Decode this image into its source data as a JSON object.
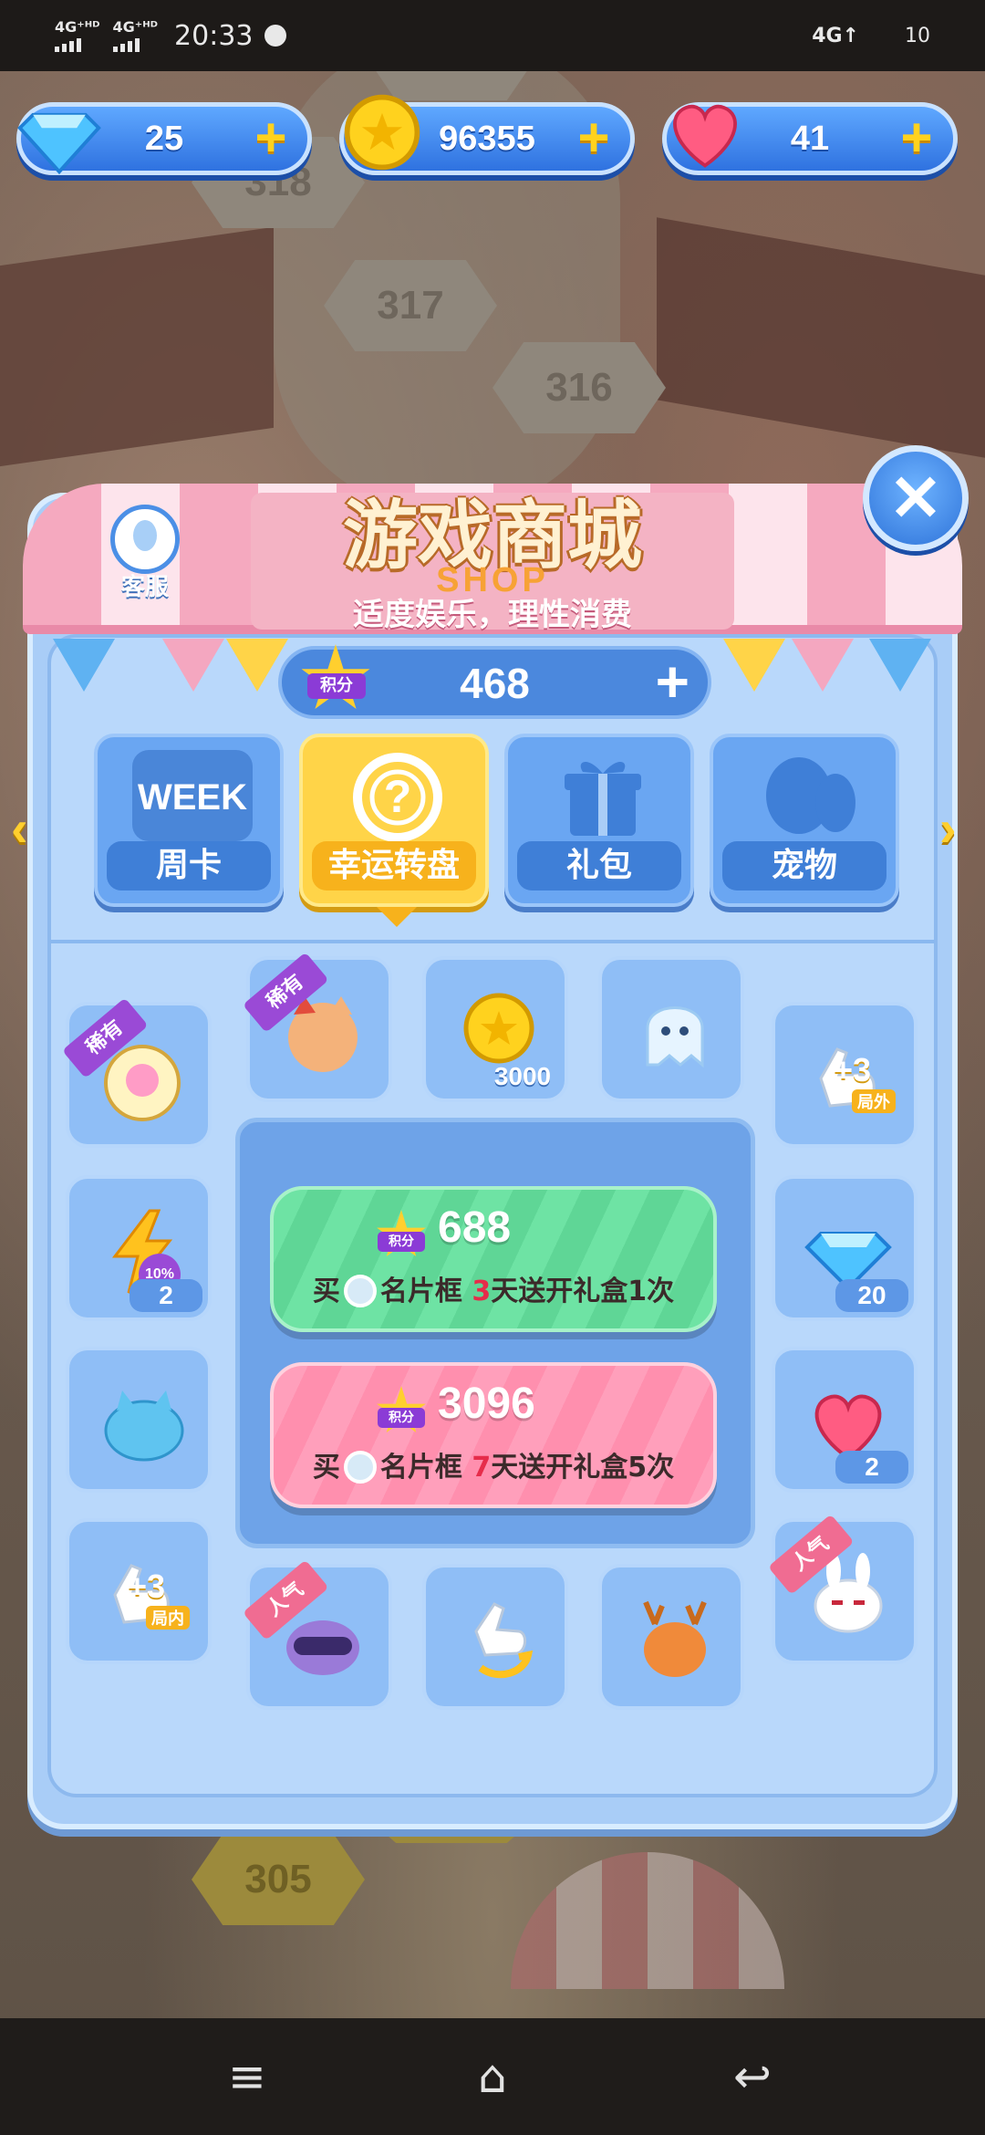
{
  "status_bar": {
    "signal_1": "4G⁺ᴴᴰ",
    "signal_2": "4G⁺ᴴᴰ",
    "time": "20:33",
    "network": "4G↑",
    "battery": "10"
  },
  "currencies": {
    "diamonds": "25",
    "coins": "96355",
    "hearts": "41",
    "add_symbol": "+"
  },
  "shop": {
    "title": "游戏商城",
    "title_en": "SHOP",
    "subtitle": "适度娱乐，理性消费",
    "customer_service": "客服",
    "close_symbol": "✕",
    "points_label": "积分",
    "points": "468",
    "points_add": "+"
  },
  "tabs": [
    {
      "label": "周卡",
      "art_text": "WEEK",
      "active": false
    },
    {
      "label": "幸运转盘",
      "art_text": "?",
      "active": true
    },
    {
      "label": "礼包",
      "art_text": "",
      "active": false
    },
    {
      "label": "宠物",
      "art_text": "",
      "active": false
    }
  ],
  "nav_arrows": {
    "left": "‹",
    "right": "›"
  },
  "items": {
    "angel_bottle": {
      "badge": "稀有"
    },
    "cat_avatar": {
      "badge": "稀有"
    },
    "coin_pack": {
      "qty": "3000"
    },
    "ghost": {},
    "plus3_outside": {
      "tag": "+3",
      "sub": "局外"
    },
    "lightning": {
      "pct": "10%",
      "qty": "2"
    },
    "diamond_pack": {
      "qty": "20"
    },
    "blue_cat": {},
    "heart_pack": {
      "qty": "2"
    },
    "plus3_inside": {
      "tag": "+3",
      "sub": "局内"
    },
    "goggle_cat": {
      "badge": "人气"
    },
    "undo_hand": {},
    "deer": {},
    "bunny": {
      "badge": "人气"
    }
  },
  "deals": [
    {
      "points_label": "积分",
      "price": "688",
      "desc_a": "买",
      "desc_b": "名片框",
      "desc_num": "3",
      "desc_c": "天送开礼盒1次"
    },
    {
      "points_label": "积分",
      "price": "3096",
      "desc_a": "买",
      "desc_b": "名片框",
      "desc_num": "7",
      "desc_c": "天送开礼盒5次"
    }
  ],
  "nav_bar": {
    "menu": "≡",
    "home": "⌂",
    "back": "↩"
  },
  "colors": {
    "panel": "#a9cdf7",
    "tab_active": "#ffd448",
    "deal_green": "#6ee3a4",
    "deal_pink": "#ff9fbb",
    "highlight_red": "#e62c4a",
    "points_purple": "#8b3bd6"
  }
}
